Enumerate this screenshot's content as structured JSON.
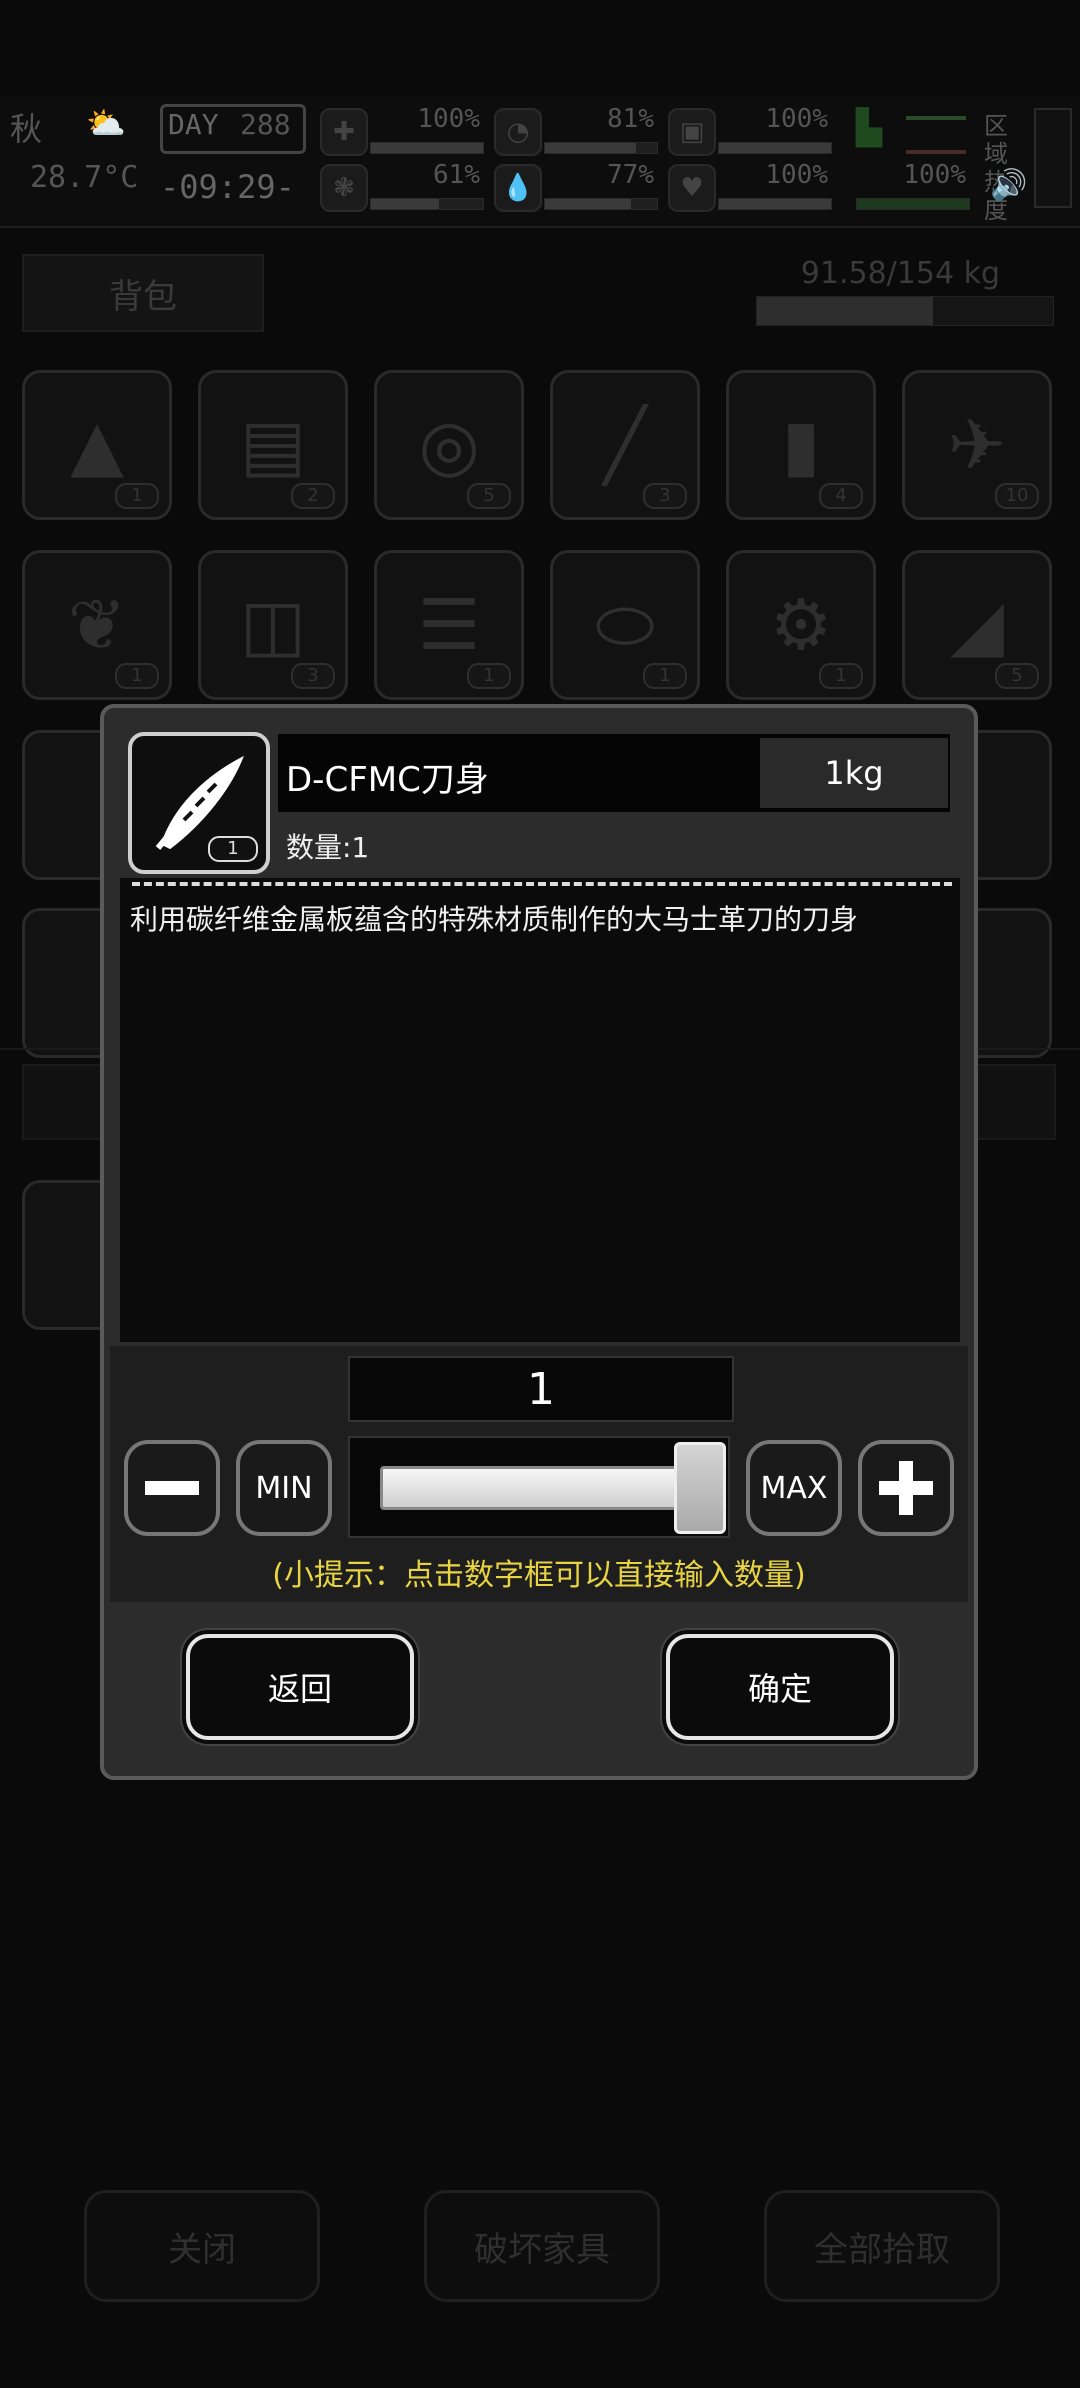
{
  "status": {
    "season": "秋",
    "temperature": "28.7°C",
    "day_label": "DAY",
    "day_number": "288",
    "time": "-09:29-",
    "stats": [
      {
        "name": "medkit-icon",
        "value": "100%",
        "fill": 1.0
      },
      {
        "name": "stomach-icon",
        "value": "81%",
        "fill": 0.81
      },
      {
        "name": "stamina-icon",
        "value": "100%",
        "fill": 1.0
      },
      {
        "name": "brain-icon",
        "value": "61%",
        "fill": 0.61
      },
      {
        "name": "water-icon",
        "value": "77%",
        "fill": 0.77
      },
      {
        "name": "heart-icon",
        "value": "100%",
        "fill": 1.0
      }
    ],
    "region_heat": "区域热度",
    "foot_value": "100%"
  },
  "backpack": {
    "tab_label": "背包",
    "weight": "91.58/154 kg",
    "weight_fraction": 0.595,
    "rows": [
      [
        {
          "icon": "arrowhead-icon",
          "count": "1"
        },
        {
          "icon": "towel-icon",
          "count": "2"
        },
        {
          "icon": "rope-icon",
          "count": "5"
        },
        {
          "icon": "needle-icon",
          "count": "3"
        },
        {
          "icon": "bottle-icon",
          "count": "4"
        },
        {
          "icon": "rocket-icon",
          "count": "10"
        }
      ],
      [
        {
          "icon": "scroll-icon",
          "count": "1"
        },
        {
          "icon": "drink-icon",
          "count": "3"
        },
        {
          "icon": "cloth-stack-icon",
          "count": "1"
        },
        {
          "icon": "can-icon",
          "count": "1"
        },
        {
          "icon": "gear-parts-icon",
          "count": "1"
        },
        {
          "icon": "fabric-icon",
          "count": "5"
        }
      ]
    ]
  },
  "bottom_buttons": {
    "close": "关闭",
    "break_furniture": "破坏家具",
    "pick_all": "全部拾取"
  },
  "dialog": {
    "item_name": "D-CFMC刀身",
    "item_weight": "1kg",
    "item_count": "1",
    "quantity_text": "数量:1",
    "description": "利用碳纤维金属板蕴含的特殊材质制作的大马士革刀的刀身",
    "number_value": "1",
    "min_label": "MIN",
    "max_label": "MAX",
    "slider_fraction": 1.0,
    "tip": "(小提示：点击数字框可以直接输入数量)",
    "back_label": "返回",
    "confirm_label": "确定"
  }
}
